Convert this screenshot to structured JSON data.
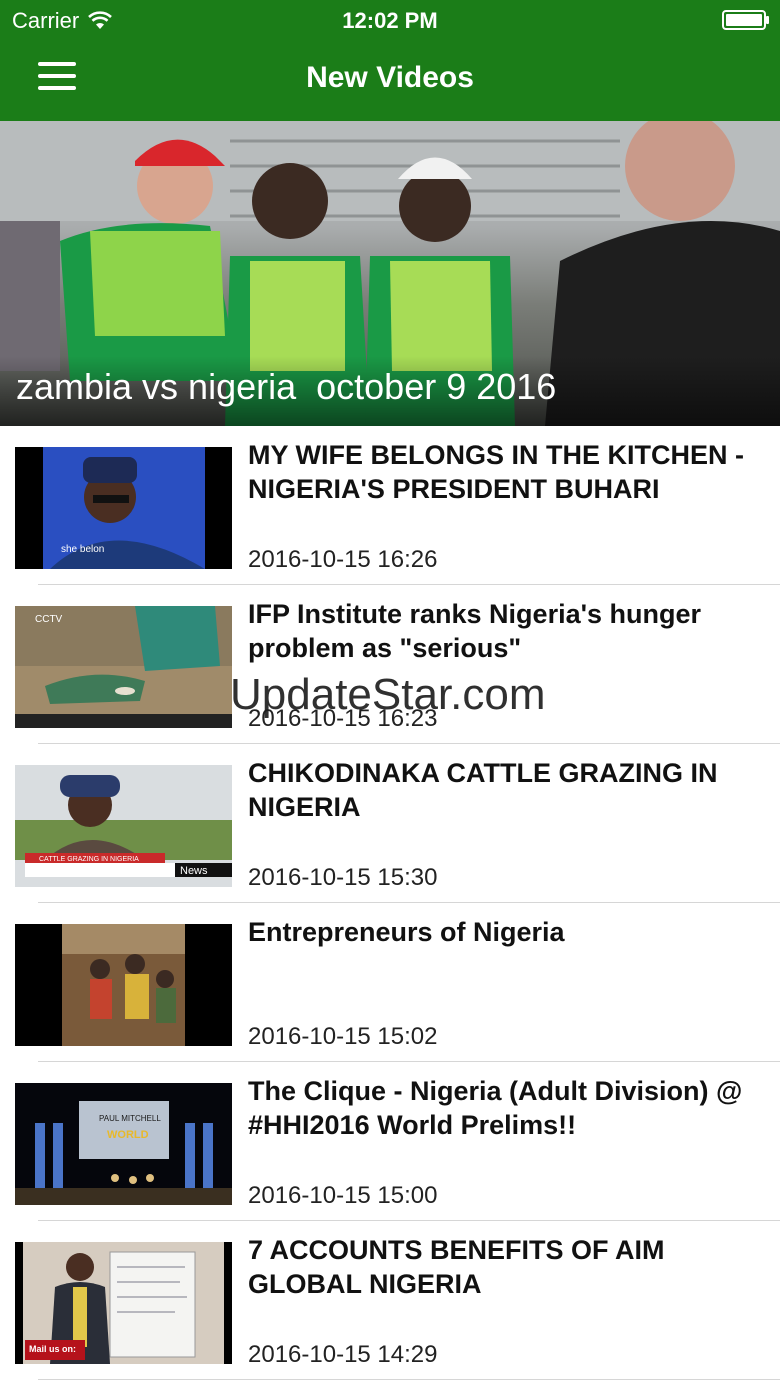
{
  "status_bar": {
    "carrier": "Carrier",
    "time": "12:02 PM"
  },
  "nav": {
    "title": "New Videos"
  },
  "featured": {
    "title": "zambia vs nigeria  october 9 2016"
  },
  "videos": [
    {
      "title": "MY WIFE BELONGS IN THE KITCHEN - NIGERIA'S PRESIDENT BUHARI",
      "date": "2016-10-15 16:26",
      "thumb_caption": "she belon"
    },
    {
      "title": "IFP Institute ranks Nigeria's hunger problem as \"serious\"",
      "date": "2016-10-15 16:23"
    },
    {
      "title": "CHIKODINAKA CATTLE GRAZING IN NIGERIA",
      "date": "2016-10-15 15:30",
      "thumb_caption": "CATTLE GRAZING IN NIGERIA",
      "thumb_badge": "News"
    },
    {
      "title": "Entrepreneurs of Nigeria",
      "date": "2016-10-15 15:02"
    },
    {
      "title": "The Clique - Nigeria (Adult Division) @ #HHI2016 World Prelims!!",
      "date": "2016-10-15 15:00"
    },
    {
      "title": "7 ACCOUNTS BENEFITS OF AIM GLOBAL NIGERIA",
      "date": "2016-10-15 14:29",
      "thumb_caption": "Mail us on:"
    }
  ],
  "watermark": "UpdateStar.com",
  "colors": {
    "brand_green": "#1b7d18",
    "separator": "#d6d6d6"
  }
}
